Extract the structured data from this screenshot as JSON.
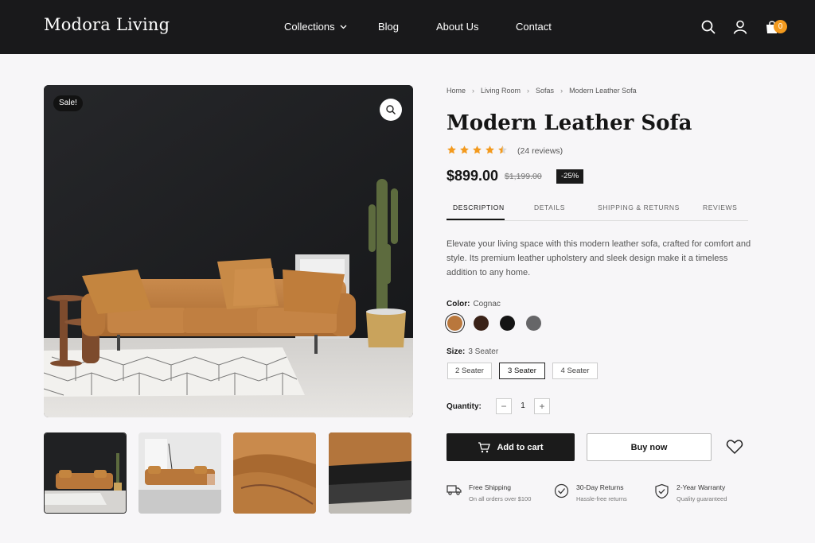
{
  "header": {
    "logo": "Modora Living",
    "nav": [
      "Collections",
      "Blog",
      "About Us",
      "Contact"
    ],
    "cart_count": "0"
  },
  "gallery": {
    "sale_badge": "Sale!",
    "thumbnail_count": 4
  },
  "breadcrumb": [
    "Home",
    "Living Room",
    "Sofas",
    "Modern Leather Sofa"
  ],
  "product": {
    "title": "Modern Leather Sofa",
    "rating": 4.5,
    "reviews": "(24 reviews)",
    "price": "$899.00",
    "old_price": "$1,199.00",
    "discount": "-25%",
    "description": "Elevate your living space with this modern leather sofa, crafted for comfort and style. Its premium leather upholstery and sleek design make it a timeless addition to any home."
  },
  "tabs": [
    "DESCRIPTION",
    "DETAILS",
    "SHIPPING & RETURNS",
    "REVIEWS"
  ],
  "options": {
    "color_label": "Color:",
    "color_value": "Cognac",
    "swatches": [
      "#b9773c",
      "#3a2218",
      "#141414",
      "#666668"
    ],
    "size_label": "Size:",
    "size_value": "3 Seater",
    "sizes": [
      "2 Seater",
      "3 Seater",
      "4 Seater"
    ],
    "quantity_label": "Quantity:",
    "quantity": "1",
    "minus": "−",
    "plus": "+"
  },
  "actions": {
    "add_to_cart": "Add to cart",
    "buy_now": "Buy now"
  },
  "features": [
    {
      "title": "Free Shipping",
      "sub": "On all orders over $100"
    },
    {
      "title": "30-Day Returns",
      "sub": "Hassle-free returns"
    },
    {
      "title": "2-Year Warranty",
      "sub": "Quality guaranteed"
    }
  ],
  "colors": {
    "accent": "#f39a1e",
    "dark": "#1b1b1b",
    "leather": "#b9773c"
  }
}
